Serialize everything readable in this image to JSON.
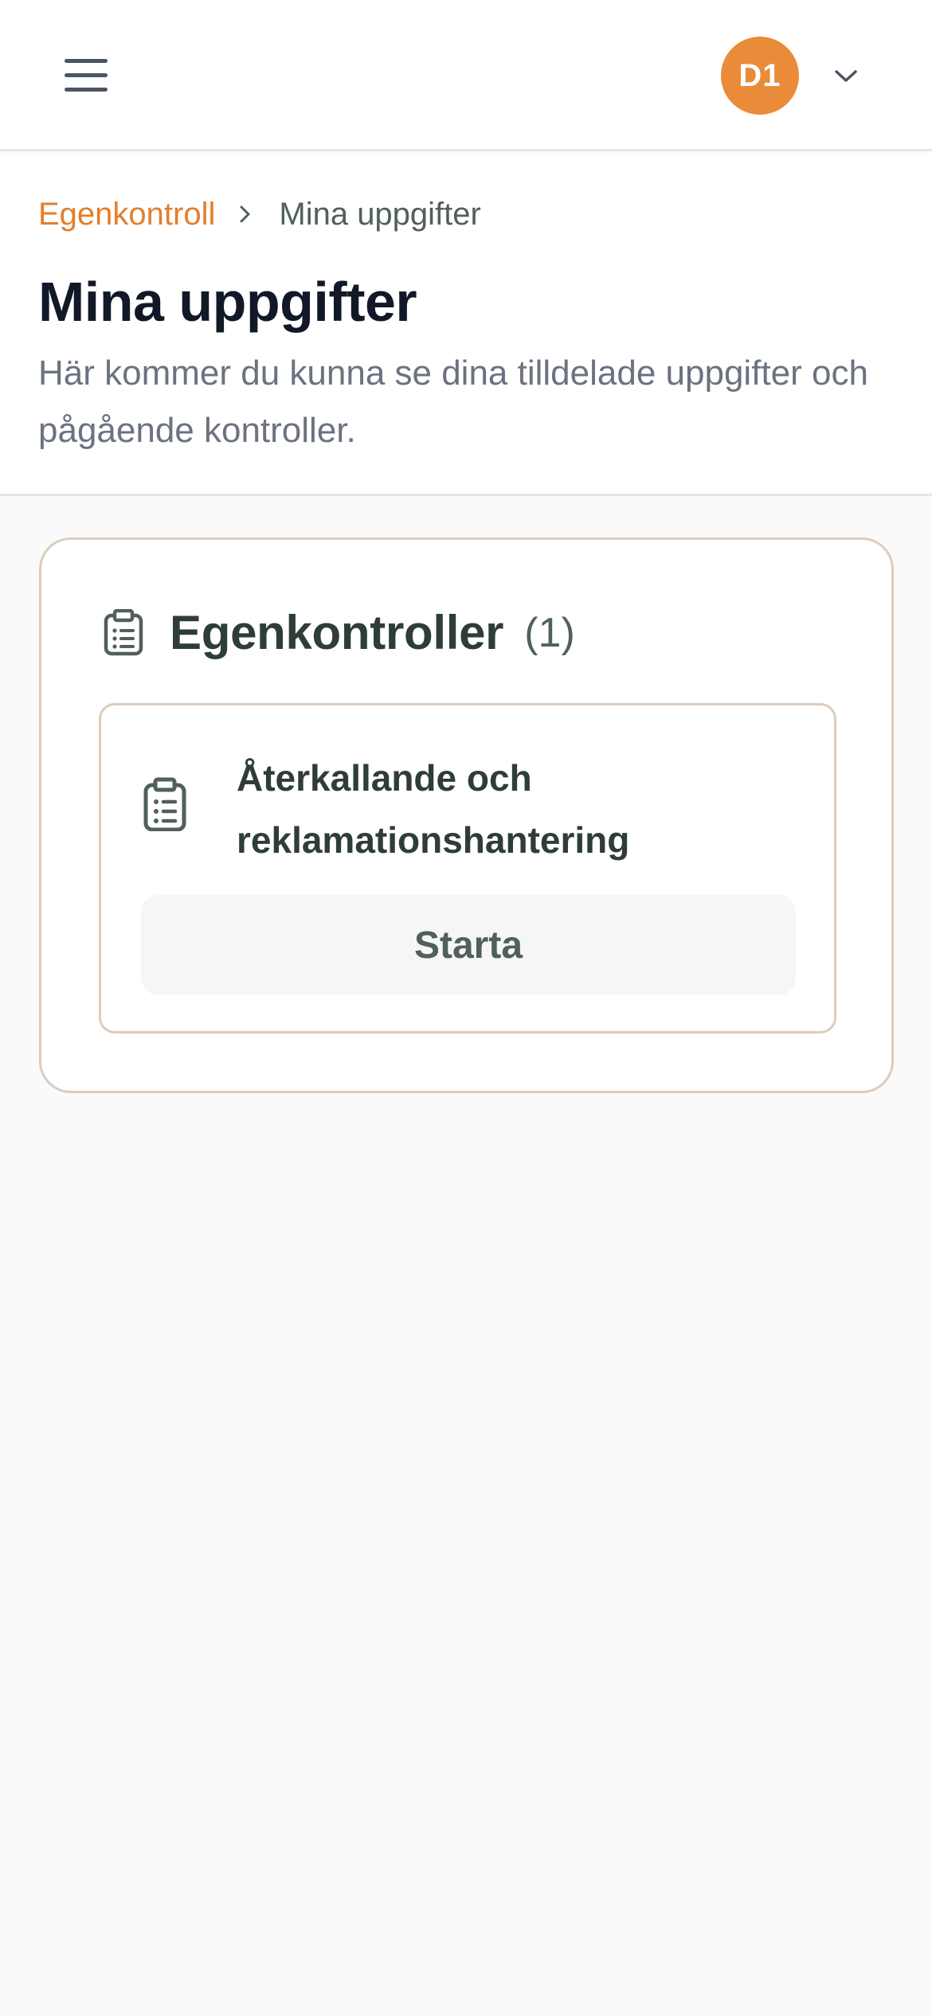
{
  "topbar": {
    "menu_icon": "hamburger-menu-icon",
    "avatar_initials": "D1",
    "avatar_color": "#ea8b3a",
    "account_menu_icon": "chevron-down-icon"
  },
  "breadcrumb": {
    "items": [
      {
        "label": "Egenkontroll"
      },
      {
        "label": "Mina uppgifter"
      }
    ],
    "separator_icon": "chevron-right-icon"
  },
  "page": {
    "title": "Mina uppgifter",
    "description": "Här kommer du kunna se dina tilldelade uppgifter och pågående kontroller."
  },
  "section": {
    "icon": "clipboard-list-icon",
    "title": "Egenkontroller",
    "count": "(1)",
    "tasks": [
      {
        "icon": "clipboard-list-icon",
        "title": "Återkallande och reklamationshantering",
        "action_label": "Starta"
      }
    ]
  },
  "colors": {
    "accent": "#e47e2c",
    "card_border": "#dcccbd",
    "heading": "#111827",
    "text_muted": "#6b7280",
    "text_dark_green": "#2f3d39"
  }
}
